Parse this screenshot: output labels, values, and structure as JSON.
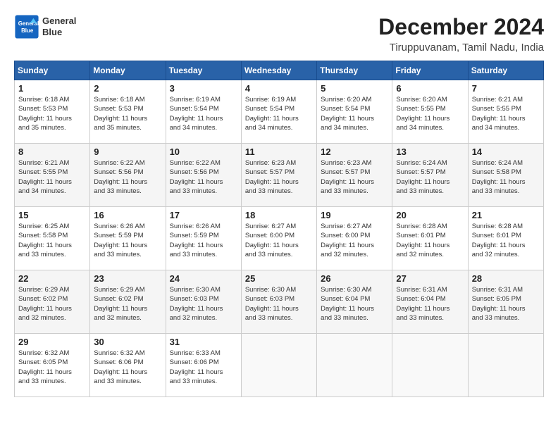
{
  "header": {
    "logo_line1": "General",
    "logo_line2": "Blue",
    "title": "December 2024",
    "subtitle": "Tiruppuvanam, Tamil Nadu, India"
  },
  "calendar": {
    "weekdays": [
      "Sunday",
      "Monday",
      "Tuesday",
      "Wednesday",
      "Thursday",
      "Friday",
      "Saturday"
    ],
    "weeks": [
      [
        {
          "day": "1",
          "text": "Sunrise: 6:18 AM\nSunset: 5:53 PM\nDaylight: 11 hours\nand 35 minutes."
        },
        {
          "day": "2",
          "text": "Sunrise: 6:18 AM\nSunset: 5:53 PM\nDaylight: 11 hours\nand 35 minutes."
        },
        {
          "day": "3",
          "text": "Sunrise: 6:19 AM\nSunset: 5:54 PM\nDaylight: 11 hours\nand 34 minutes."
        },
        {
          "day": "4",
          "text": "Sunrise: 6:19 AM\nSunset: 5:54 PM\nDaylight: 11 hours\nand 34 minutes."
        },
        {
          "day": "5",
          "text": "Sunrise: 6:20 AM\nSunset: 5:54 PM\nDaylight: 11 hours\nand 34 minutes."
        },
        {
          "day": "6",
          "text": "Sunrise: 6:20 AM\nSunset: 5:55 PM\nDaylight: 11 hours\nand 34 minutes."
        },
        {
          "day": "7",
          "text": "Sunrise: 6:21 AM\nSunset: 5:55 PM\nDaylight: 11 hours\nand 34 minutes."
        }
      ],
      [
        {
          "day": "8",
          "text": "Sunrise: 6:21 AM\nSunset: 5:55 PM\nDaylight: 11 hours\nand 34 minutes."
        },
        {
          "day": "9",
          "text": "Sunrise: 6:22 AM\nSunset: 5:56 PM\nDaylight: 11 hours\nand 33 minutes."
        },
        {
          "day": "10",
          "text": "Sunrise: 6:22 AM\nSunset: 5:56 PM\nDaylight: 11 hours\nand 33 minutes."
        },
        {
          "day": "11",
          "text": "Sunrise: 6:23 AM\nSunset: 5:57 PM\nDaylight: 11 hours\nand 33 minutes."
        },
        {
          "day": "12",
          "text": "Sunrise: 6:23 AM\nSunset: 5:57 PM\nDaylight: 11 hours\nand 33 minutes."
        },
        {
          "day": "13",
          "text": "Sunrise: 6:24 AM\nSunset: 5:57 PM\nDaylight: 11 hours\nand 33 minutes."
        },
        {
          "day": "14",
          "text": "Sunrise: 6:24 AM\nSunset: 5:58 PM\nDaylight: 11 hours\nand 33 minutes."
        }
      ],
      [
        {
          "day": "15",
          "text": "Sunrise: 6:25 AM\nSunset: 5:58 PM\nDaylight: 11 hours\nand 33 minutes."
        },
        {
          "day": "16",
          "text": "Sunrise: 6:26 AM\nSunset: 5:59 PM\nDaylight: 11 hours\nand 33 minutes."
        },
        {
          "day": "17",
          "text": "Sunrise: 6:26 AM\nSunset: 5:59 PM\nDaylight: 11 hours\nand 33 minutes."
        },
        {
          "day": "18",
          "text": "Sunrise: 6:27 AM\nSunset: 6:00 PM\nDaylight: 11 hours\nand 33 minutes."
        },
        {
          "day": "19",
          "text": "Sunrise: 6:27 AM\nSunset: 6:00 PM\nDaylight: 11 hours\nand 32 minutes."
        },
        {
          "day": "20",
          "text": "Sunrise: 6:28 AM\nSunset: 6:01 PM\nDaylight: 11 hours\nand 32 minutes."
        },
        {
          "day": "21",
          "text": "Sunrise: 6:28 AM\nSunset: 6:01 PM\nDaylight: 11 hours\nand 32 minutes."
        }
      ],
      [
        {
          "day": "22",
          "text": "Sunrise: 6:29 AM\nSunset: 6:02 PM\nDaylight: 11 hours\nand 32 minutes."
        },
        {
          "day": "23",
          "text": "Sunrise: 6:29 AM\nSunset: 6:02 PM\nDaylight: 11 hours\nand 32 minutes."
        },
        {
          "day": "24",
          "text": "Sunrise: 6:30 AM\nSunset: 6:03 PM\nDaylight: 11 hours\nand 32 minutes."
        },
        {
          "day": "25",
          "text": "Sunrise: 6:30 AM\nSunset: 6:03 PM\nDaylight: 11 hours\nand 33 minutes."
        },
        {
          "day": "26",
          "text": "Sunrise: 6:30 AM\nSunset: 6:04 PM\nDaylight: 11 hours\nand 33 minutes."
        },
        {
          "day": "27",
          "text": "Sunrise: 6:31 AM\nSunset: 6:04 PM\nDaylight: 11 hours\nand 33 minutes."
        },
        {
          "day": "28",
          "text": "Sunrise: 6:31 AM\nSunset: 6:05 PM\nDaylight: 11 hours\nand 33 minutes."
        }
      ],
      [
        {
          "day": "29",
          "text": "Sunrise: 6:32 AM\nSunset: 6:05 PM\nDaylight: 11 hours\nand 33 minutes."
        },
        {
          "day": "30",
          "text": "Sunrise: 6:32 AM\nSunset: 6:06 PM\nDaylight: 11 hours\nand 33 minutes."
        },
        {
          "day": "31",
          "text": "Sunrise: 6:33 AM\nSunset: 6:06 PM\nDaylight: 11 hours\nand 33 minutes."
        },
        null,
        null,
        null,
        null
      ]
    ]
  }
}
